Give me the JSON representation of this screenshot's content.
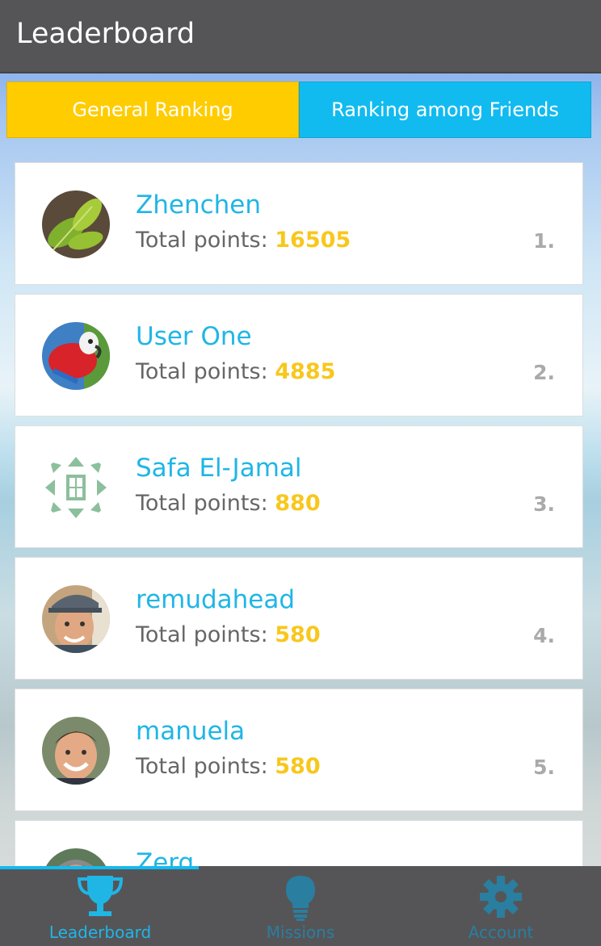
{
  "header": {
    "title": "Leaderboard"
  },
  "tabs": [
    {
      "label": "General Ranking",
      "active": true
    },
    {
      "label": "Ranking among Friends",
      "active": false
    }
  ],
  "points_label": "Total points:",
  "entries": [
    {
      "name": "Zhenchen",
      "points": "16505",
      "rank": "1.",
      "avatar": "leaf-avatar"
    },
    {
      "name": "User One",
      "points": "4885",
      "rank": "2.",
      "avatar": "parrot-avatar"
    },
    {
      "name": "Safa El-Jamal",
      "points": "880",
      "rank": "3.",
      "avatar": "identicon-avatar"
    },
    {
      "name": "remudahead",
      "points": "580",
      "rank": "4.",
      "avatar": "photo-avatar"
    },
    {
      "name": "manuela",
      "points": "580",
      "rank": "5.",
      "avatar": "photo-avatar"
    },
    {
      "name": "Zerg",
      "points": "",
      "rank": "",
      "avatar": "photo-avatar"
    }
  ],
  "nav": [
    {
      "label": "Leaderboard",
      "icon": "trophy-icon",
      "active": true
    },
    {
      "label": "Missions",
      "icon": "lightbulb-icon",
      "active": false
    },
    {
      "label": "Account",
      "icon": "gear-icon",
      "active": false
    }
  ],
  "colors": {
    "header_bg": "#555557",
    "tab_active": "#ffcc00",
    "tab_inactive": "#11bbf0",
    "name": "#1fb6e6",
    "points": "#f8c71c",
    "rank": "#aaaaaa"
  }
}
